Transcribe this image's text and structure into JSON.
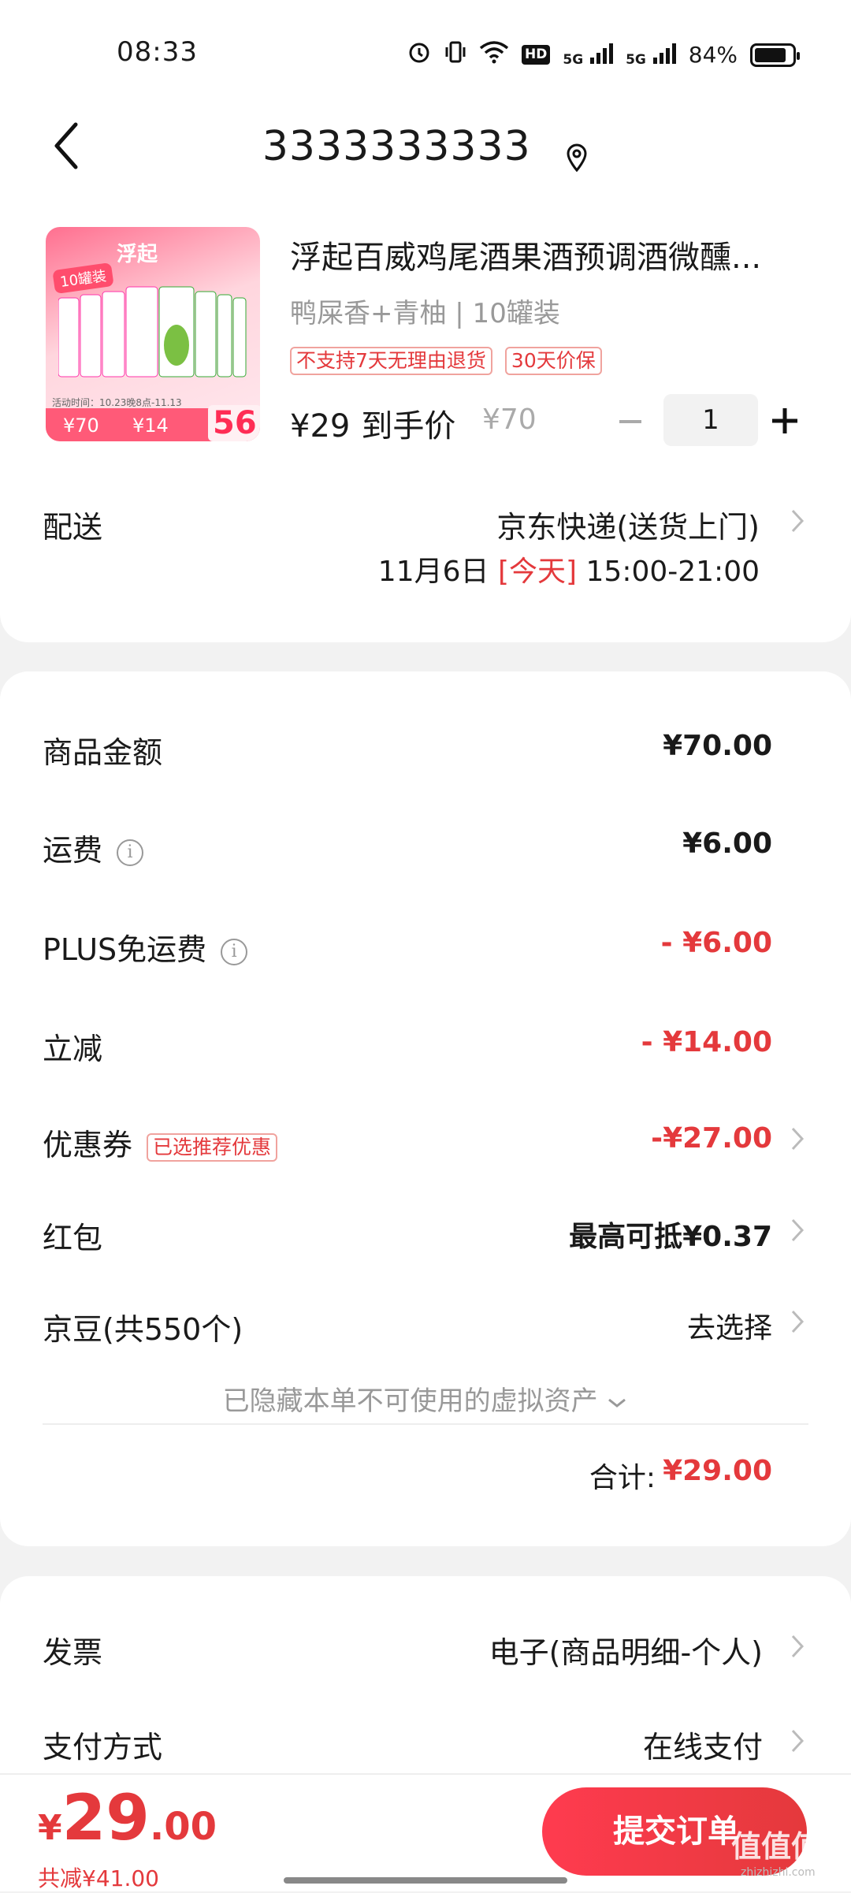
{
  "status_bar": {
    "time": "08:33",
    "hd_label": "HD",
    "net1": "5G",
    "net2": "5G",
    "battery": "84%"
  },
  "header": {
    "title": "3333333333",
    "back_icon": "chevron-left-icon",
    "location_icon": "location-pin-icon"
  },
  "product": {
    "name": "浮起百威鸡尾酒果酒预调酒微醺...",
    "spec": "鸭屎香+青柚 | 10罐装",
    "tags": [
      "不支持7天无理由退货",
      "30天价保"
    ],
    "price": "¥29",
    "price_suffix": "到手价",
    "original_price": "¥70",
    "quantity": "1",
    "thumbnail": {
      "brand": "浮起",
      "badge": "10罐装",
      "activity": "活动时间：10.23晚8点-11.13",
      "price1": "¥70",
      "price2": "¥14",
      "price3": "56"
    }
  },
  "delivery": {
    "label": "配送",
    "method": "京东快递(送货上门)",
    "date": "11月6日",
    "today": "[今天]",
    "time_range": "15:00-21:00"
  },
  "summary": {
    "goods_amount": {
      "label": "商品金额",
      "value": "¥70.00"
    },
    "shipping": {
      "label": "运费",
      "value": "¥6.00"
    },
    "plus_free_shipping": {
      "label": "PLUS免运费",
      "value": "- ¥6.00"
    },
    "instant_discount": {
      "label": "立减",
      "value": "- ¥14.00"
    },
    "coupon": {
      "label": "优惠券",
      "tag": "已选推荐优惠",
      "value": "-¥27.00"
    },
    "red_packet": {
      "label": "红包",
      "value": "最高可抵¥0.37"
    },
    "jd_beans": {
      "label": "京豆(共550个)",
      "value": "去选择"
    },
    "hidden_note": "已隐藏本单不可使用的虚拟资产",
    "total_label": "合计:",
    "total_value": "¥29.00"
  },
  "invoice": {
    "label": "发票",
    "value": "电子(商品明细-个人)"
  },
  "payment": {
    "label": "支付方式",
    "value": "在线支付"
  },
  "footer": {
    "yen": "¥",
    "amount_int": "29",
    "amount_dec": ".00",
    "saved": "共减¥41.00",
    "submit_label": "提交订单",
    "watermark": "值值值",
    "watermark_sub": "zhizhizhi.com"
  },
  "colors": {
    "accent": "#e4393c",
    "background": "#f2f2f2"
  }
}
